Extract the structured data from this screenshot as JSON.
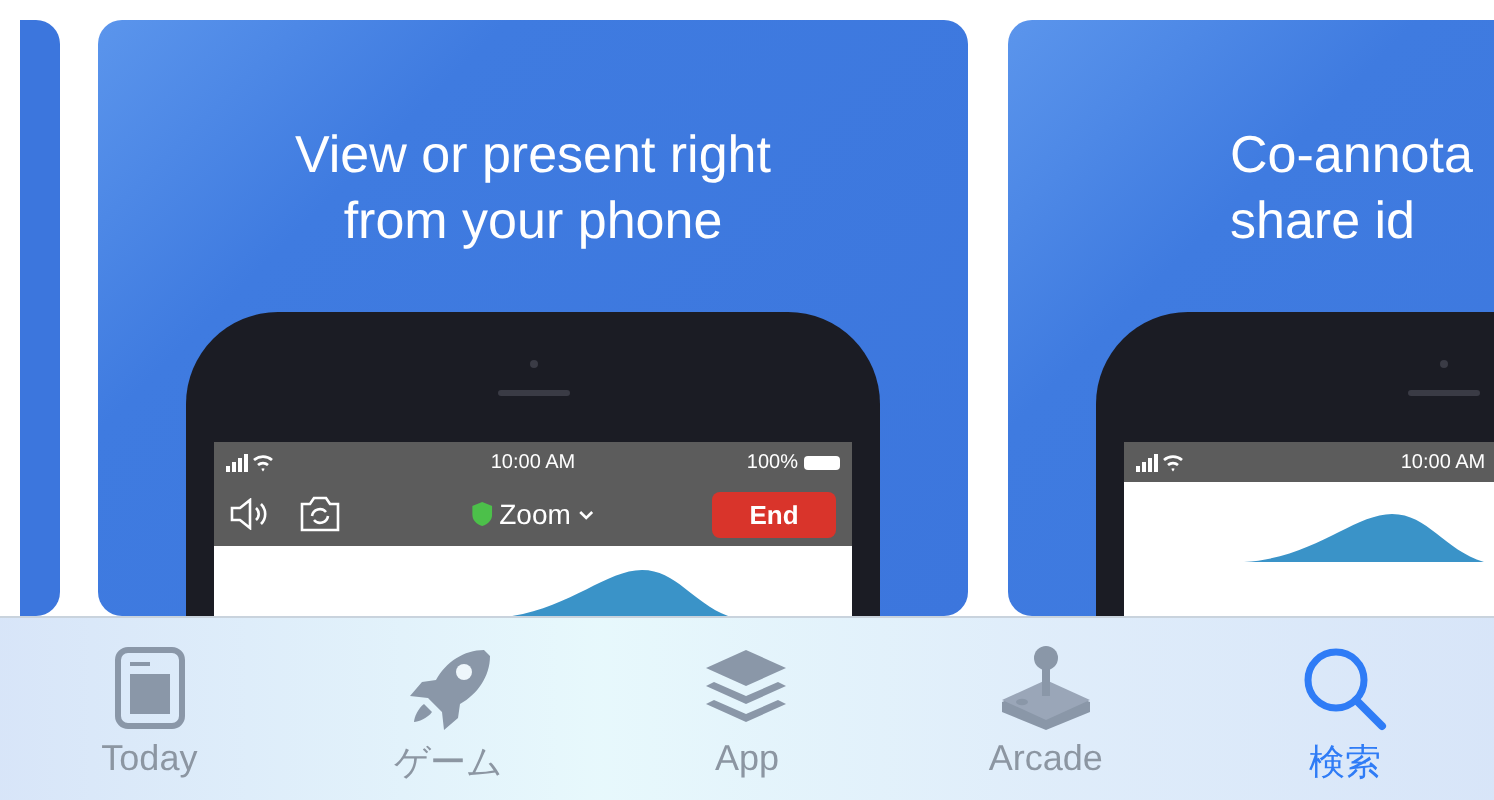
{
  "cards": [
    {
      "caption_lines": [
        "View or present right",
        "from your phone"
      ],
      "kind": "full",
      "phone": {
        "status_time": "10:00 AM",
        "battery": "100%",
        "meeting": {
          "name": "Zoom",
          "end_button": "End"
        }
      }
    },
    {
      "caption_lines": [
        "Co-annota",
        "share id"
      ],
      "kind": "cut",
      "phone": {
        "status_time": "10:00 AM"
      }
    }
  ],
  "tabs": [
    {
      "kind": "today",
      "label": "Today",
      "selected": false
    },
    {
      "kind": "games",
      "label": "ゲーム",
      "selected": false
    },
    {
      "kind": "apps",
      "label": "App",
      "selected": false
    },
    {
      "kind": "arcade",
      "label": "Arcade",
      "selected": false
    },
    {
      "kind": "search",
      "label": "検索",
      "selected": true
    }
  ]
}
